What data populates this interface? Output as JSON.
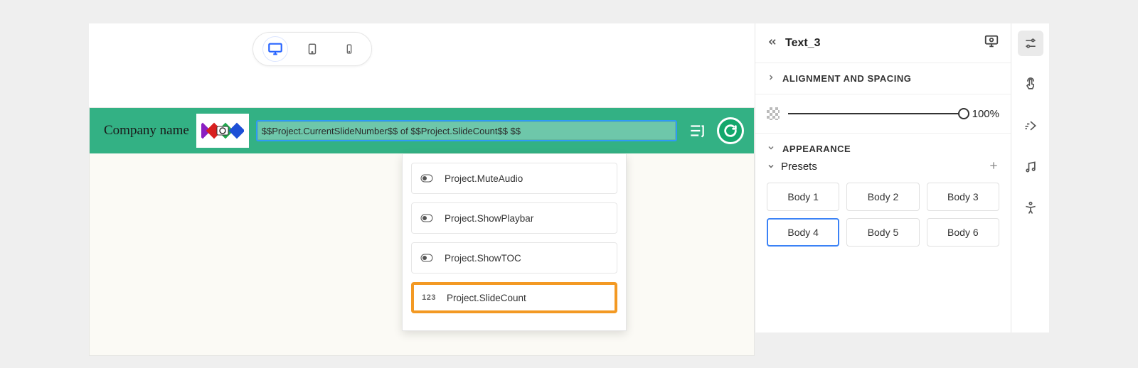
{
  "device_switcher": {
    "active": "desktop"
  },
  "header": {
    "company_label": "Company name",
    "variable_expression": "$$Project.CurrentSlideNumber$$ of $$Project.SlideCount$$ $$"
  },
  "autocomplete": {
    "items": [
      {
        "type": "toggle",
        "label": "Project.MuteAudio"
      },
      {
        "type": "toggle",
        "label": "Project.ShowPlaybar"
      },
      {
        "type": "toggle",
        "label": "Project.ShowTOC"
      },
      {
        "type": "number",
        "label": "Project.SlideCount",
        "highlighted": true
      }
    ]
  },
  "inspector": {
    "title": "Text_3",
    "sections": {
      "alignment_spacing": {
        "label": "Alignment and spacing",
        "expanded": false
      },
      "appearance": {
        "label": "Appearance",
        "expanded": true
      }
    },
    "opacity": {
      "value_text": "100%",
      "value": 100
    },
    "presets": {
      "label": "Presets",
      "items": [
        "Body 1",
        "Body 2",
        "Body 3",
        "Body 4",
        "Body 5",
        "Body 6"
      ],
      "selected_index": 3
    }
  }
}
